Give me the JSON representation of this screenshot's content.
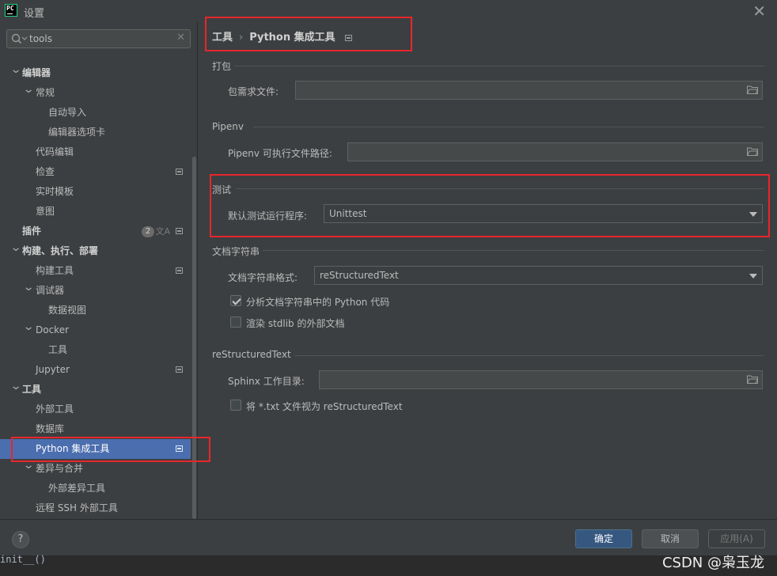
{
  "window": {
    "app_logo_text": "PC",
    "title": "设置",
    "close_glyph": "✕"
  },
  "search": {
    "value": "tools",
    "clear_glyph": "✕"
  },
  "sidebar": {
    "items": [
      {
        "label": "编辑器",
        "chevron": "v",
        "bold": true
      },
      {
        "label": "常规",
        "chevron": "v"
      },
      {
        "label": "自动导入"
      },
      {
        "label": "编辑器选项卡"
      },
      {
        "label": "代码编辑"
      },
      {
        "label": "检查",
        "project_icon": true
      },
      {
        "label": "实时模板"
      },
      {
        "label": "意图"
      },
      {
        "label": "插件",
        "bold": true,
        "badge": "2",
        "project_icon": true
      },
      {
        "label": "构建、执行、部署",
        "chevron": "v",
        "bold": true
      },
      {
        "label": "构建工具",
        "project_icon": true
      },
      {
        "label": "调试器",
        "chevron": "v"
      },
      {
        "label": "数据视图"
      },
      {
        "label": "Docker",
        "chevron": "v"
      },
      {
        "label": "工具"
      },
      {
        "label": "Jupyter",
        "project_icon": true
      },
      {
        "label": "工具",
        "chevron": "v",
        "bold": true
      },
      {
        "label": "外部工具"
      },
      {
        "label": "数据库"
      },
      {
        "label": "Python 集成工具",
        "selected": true,
        "project_icon": true
      },
      {
        "label": "差异与合并",
        "chevron": "v"
      },
      {
        "label": "外部差异工具"
      },
      {
        "label": "远程 SSH 外部工具"
      }
    ]
  },
  "breadcrumb": {
    "root": "工具",
    "separator": "›",
    "current": "Python 集成工具"
  },
  "sections": {
    "packaging": {
      "title": "打包",
      "requirements_label": "包需求文件:",
      "requirements_value": ""
    },
    "pipenv": {
      "title": "Pipenv",
      "path_label": "Pipenv 可执行文件路径:",
      "path_value": ""
    },
    "testing": {
      "title": "测试",
      "runner_label": "默认测试运行程序:",
      "runner_value": "Unittest"
    },
    "docstrings": {
      "title": "文档字符串",
      "format_label": "文档字符串格式:",
      "format_value": "reStructuredText",
      "analyze_label": "分析文档字符串中的 Python 代码",
      "analyze_checked": true,
      "render_label": "渲染 stdlib 的外部文档",
      "render_checked": false
    },
    "restructured": {
      "title": "reStructuredText",
      "sphinx_label": "Sphinx 工作目录:",
      "sphinx_value": "",
      "treat_txt_label": "将 *.txt 文件视为 reStructuredText",
      "treat_txt_checked": false
    }
  },
  "footer": {
    "help": "?",
    "ok": "确定",
    "cancel": "取消",
    "apply": "应用(A)"
  },
  "background": {
    "code_text": "init__()",
    "watermark": "CSDN @枭玉龙"
  },
  "colors": {
    "background": "#3c3f41",
    "selection": "#4b6eaf",
    "primary_button": "#365880",
    "annotation": "#e8262c"
  }
}
